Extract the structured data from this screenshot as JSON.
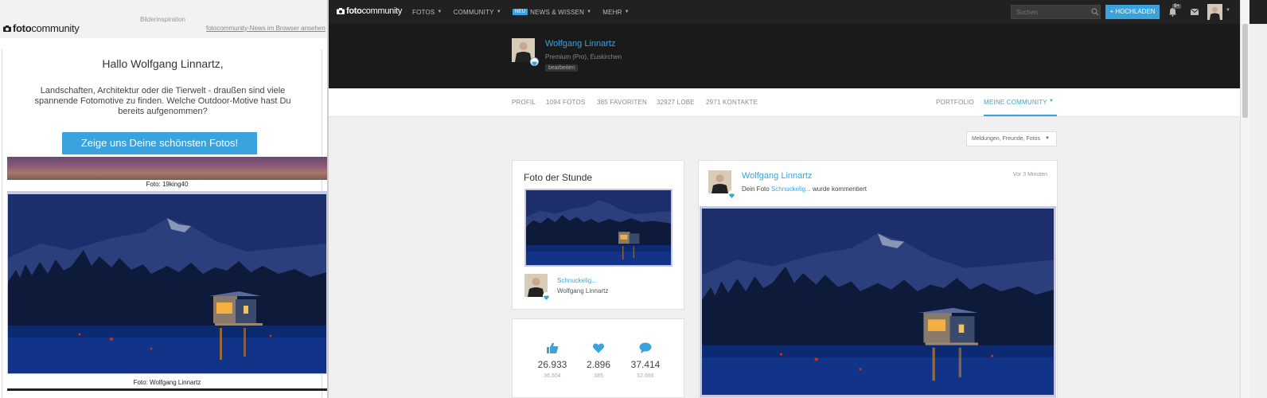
{
  "email": {
    "logo": "fotocommunity",
    "kicker": "Bilderinspiration",
    "browser_link": "fotocommunity-News im Browser ansehen",
    "greeting": "Hallo Wolfgang Linnartz,",
    "intro": "Landschaften, Architektur oder die Tierwelt - draußen sind viele spannende Fotomotive zu finden. Welche Outdoor-Motive hast Du bereits aufgenommen?",
    "cta": "Zeige uns Deine schönsten Fotos!",
    "caption1": "Foto: 19king40",
    "caption2": "Foto: Wolfgang Linnartz"
  },
  "site": {
    "logo": "fotocommunity",
    "nav": [
      {
        "label": "FOTOS"
      },
      {
        "label": "COMMUNITY"
      },
      {
        "badge": "NEU",
        "label": "NEWS & WISSEN"
      },
      {
        "label": "MEHR"
      }
    ],
    "search_placeholder": "Suchen",
    "upload_label": "+ HOCHLADEN",
    "notification_count": "9+",
    "profile": {
      "name": "Wolfgang Linnartz",
      "meta": "Premium (Pro), Euskirchen",
      "edit": "bearbeiten"
    },
    "tabs": {
      "profil": "PROFIL",
      "fotos": "1094 FOTOS",
      "favoriten": "385 FAVORITEN",
      "lobe": "32927 LOBE",
      "kontakte": "2971 KONTAKTE",
      "portfolio": "PORTFOLIO",
      "meine_community": "MEINE COMMUNITY"
    },
    "filter": "Meldungen, Freunde, Fotos",
    "photo_of_hour": {
      "title": "Foto der Stunde",
      "photo_title": "Schnuckelig...",
      "author": "Wolfgang Linnartz"
    },
    "stats": [
      {
        "icon": "thumbs-up-icon",
        "value": "26.933",
        "sub": "36.504"
      },
      {
        "icon": "heart-icon",
        "value": "2.896",
        "sub": "385"
      },
      {
        "icon": "comment-icon",
        "value": "37.414",
        "sub": "52.666"
      }
    ],
    "feed": {
      "name": "Wolfgang Linnartz",
      "time": "Vor 3 Minuten",
      "text_pre": "Dein Foto",
      "text_link": "Schnuckelig...",
      "text_post": "wurde kommentiert"
    },
    "colors": {
      "accent": "#3aa3dd",
      "topbar": "#212121",
      "profile_band": "#1a1a1a"
    }
  }
}
